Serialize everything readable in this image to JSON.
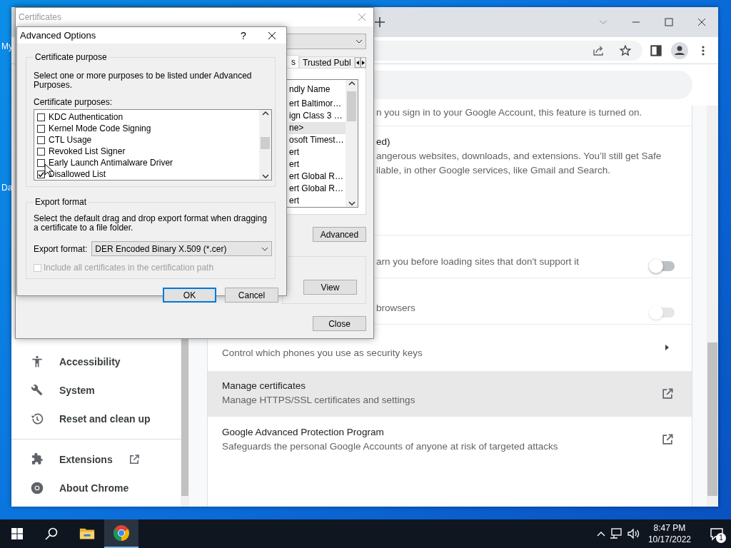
{
  "desktop": {
    "icon_labels": [
      "My",
      "Da"
    ]
  },
  "chrome": {
    "sidebar": {
      "items": [
        {
          "label": "Accessibility",
          "kind": "page"
        },
        {
          "label": "System",
          "kind": "page"
        },
        {
          "label": "Reset and clean up",
          "kind": "page"
        },
        {
          "label": "Extensions",
          "kind": "external"
        },
        {
          "label": "About Chrome",
          "kind": "page"
        }
      ]
    },
    "rows": [
      {
        "kind": "clipped",
        "lines": [
          "n you sign in to your Google Account, this feature is turned on."
        ]
      },
      {
        "kind": "clipped",
        "lines": [
          "ed)",
          "angerous websites, downloads, and extensions. You’ll still get Safe",
          "ilable, in other Google services, like Gmail and Search."
        ]
      },
      {
        "kind": "toggle",
        "lines": [
          "arn you before loading sites that don't support it"
        ],
        "on": false,
        "disabled": false
      },
      {
        "kind": "toggle",
        "lines": [
          "browsers"
        ],
        "on": false,
        "disabled": true
      },
      {
        "kind": "submenu",
        "subtitle": "Control which phones you use as security keys",
        "highlighted": false
      },
      {
        "kind": "external",
        "title": "Manage certificates",
        "subtitle": "Manage HTTPS/SSL certificates and settings",
        "highlighted": true
      },
      {
        "kind": "external",
        "title": "Google Advanced Protection Program",
        "subtitle": "Safeguards the personal Google Accounts of anyone at risk of targeted attacks",
        "highlighted": false
      }
    ]
  },
  "certificates_window": {
    "title": "Certificates",
    "tabs": [
      {
        "label": "s",
        "selected": true
      },
      {
        "label": "Trusted Publ",
        "selected": false
      }
    ],
    "list": {
      "header": "ndly Name",
      "rows": [
        {
          "text": "ert Baltimor…",
          "selected": false
        },
        {
          "text": "ign Class 3 …",
          "selected": false
        },
        {
          "text": "ne>",
          "selected": true
        },
        {
          "text": "osoft Timest…",
          "selected": false
        },
        {
          "text": "ert",
          "selected": false
        },
        {
          "text": "ert",
          "selected": false
        },
        {
          "text": "ert Global R…",
          "selected": false
        },
        {
          "text": "ert Global R…",
          "selected": false
        },
        {
          "text": "ert",
          "selected": false
        }
      ]
    },
    "advanced_button": "Advanced",
    "view_button": "View",
    "close_button": "Close"
  },
  "advanced_options": {
    "title": "Advanced Options",
    "help": "?",
    "purpose_group": {
      "legend": "Certificate purpose",
      "description": "Select one or more purposes to be listed under Advanced Purposes.",
      "list_label": "Certificate purposes:",
      "items": [
        {
          "label": "KDC Authentication",
          "checked": false
        },
        {
          "label": "Kernel Mode Code Signing",
          "checked": false
        },
        {
          "label": "CTL Usage",
          "checked": false
        },
        {
          "label": "Revoked List Signer",
          "checked": false
        },
        {
          "label": "Early Launch Antimalware Driver",
          "checked": false
        },
        {
          "label": "Disallowed List",
          "checked": true
        }
      ]
    },
    "export_group": {
      "legend": "Export format",
      "description": "Select the default drag and drop export format when dragging a certificate to a file folder.",
      "format_label": "Export format:",
      "format_value": "DER Encoded Binary X.509 (*.cer)",
      "include_all": {
        "label": "Include all certificates in the certification path",
        "checked": false,
        "disabled": true
      }
    },
    "buttons": [
      {
        "label": "OK",
        "default": true
      },
      {
        "label": "Cancel",
        "default": false
      }
    ]
  },
  "taskbar": {
    "apps": [
      {
        "kind": "start",
        "selected": false
      },
      {
        "kind": "search",
        "selected": false
      },
      {
        "kind": "explorer",
        "selected": false
      },
      {
        "kind": "chrome",
        "selected": true
      }
    ],
    "time": "8:47 PM",
    "date": "10/17/2022",
    "notification_count": "1"
  }
}
